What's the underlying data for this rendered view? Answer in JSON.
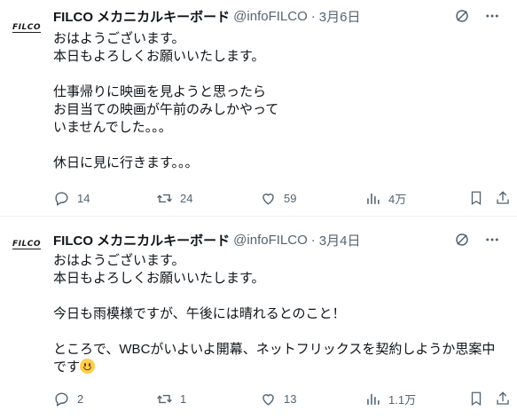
{
  "tweets": [
    {
      "avatar_text": "FILCO",
      "name": "FILCO メカニカルキーボード",
      "handle": "@infoFILCO",
      "separator": "·",
      "date": "3月6日",
      "body": "おはようございます。\n本日もよろしくお願いいたします。\n\n仕事帰りに映画を見ようと思ったら\nお目当ての映画が午前のみしかやって\nいませんでした。。。\n\n休日に見に行きます。。。",
      "replies": "14",
      "retweets": "24",
      "likes": "59",
      "views": "4万"
    },
    {
      "avatar_text": "FILCO",
      "name": "FILCO メカニカルキーボード",
      "handle": "@infoFILCO",
      "separator": "·",
      "date": "3月4日",
      "body": "おはようございます。\n本日もよろしくお願いいたします。\n\n今日も雨模様ですが、午後には晴れるとのこと！\n\nところで、WBCがいよいよ開幕、ネットフリックスを契約しようか思案中です",
      "body_emoji": "grinning-face",
      "replies": "2",
      "retweets": "1",
      "likes": "13",
      "views": "1.1万"
    }
  ],
  "colors": {
    "text": "#0f1419",
    "secondary": "#536471",
    "divider": "#eff3f4"
  },
  "icons": [
    "grok-icon",
    "more-icon",
    "reply-icon",
    "retweet-icon",
    "like-icon",
    "views-icon",
    "bookmark-icon",
    "share-icon"
  ]
}
